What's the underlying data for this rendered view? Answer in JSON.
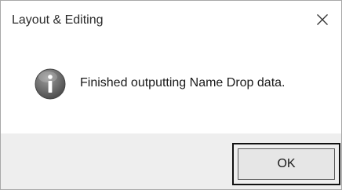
{
  "window": {
    "title": "Layout & Editing",
    "close_icon": "close-icon"
  },
  "message": {
    "icon": "info-icon",
    "text": "Finished outputting Name Drop data."
  },
  "footer": {
    "ok_label": "OK"
  }
}
